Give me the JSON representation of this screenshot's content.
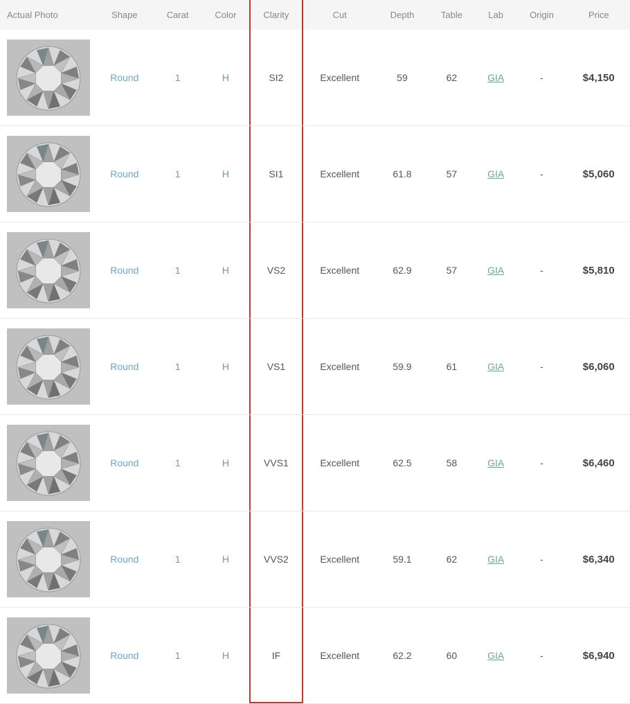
{
  "columns": {
    "actual_photo": "Actual Photo",
    "shape": "Shape",
    "carat": "Carat",
    "color": "Color",
    "clarity": "Clarity",
    "cut": "Cut",
    "depth": "Depth",
    "table": "Table",
    "lab": "Lab",
    "origin": "Origin",
    "price": "Price"
  },
  "rows": [
    {
      "shape": "Round",
      "carat": "1",
      "color": "H",
      "clarity": "SI2",
      "cut": "Excellent",
      "depth": "59",
      "table": "62",
      "lab": "GIA",
      "origin": "-",
      "price": "$4,150"
    },
    {
      "shape": "Round",
      "carat": "1",
      "color": "H",
      "clarity": "SI1",
      "cut": "Excellent",
      "depth": "61.8",
      "table": "57",
      "lab": "GIA",
      "origin": "-",
      "price": "$5,060"
    },
    {
      "shape": "Round",
      "carat": "1",
      "color": "H",
      "clarity": "VS2",
      "cut": "Excellent",
      "depth": "62.9",
      "table": "57",
      "lab": "GIA",
      "origin": "-",
      "price": "$5,810"
    },
    {
      "shape": "Round",
      "carat": "1",
      "color": "H",
      "clarity": "VS1",
      "cut": "Excellent",
      "depth": "59.9",
      "table": "61",
      "lab": "GIA",
      "origin": "-",
      "price": "$6,060"
    },
    {
      "shape": "Round",
      "carat": "1",
      "color": "H",
      "clarity": "VVS1",
      "cut": "Excellent",
      "depth": "62.5",
      "table": "58",
      "lab": "GIA",
      "origin": "-",
      "price": "$6,460"
    },
    {
      "shape": "Round",
      "carat": "1",
      "color": "H",
      "clarity": "VVS2",
      "cut": "Excellent",
      "depth": "59.1",
      "table": "62",
      "lab": "GIA",
      "origin": "-",
      "price": "$6,340"
    },
    {
      "shape": "Round",
      "carat": "1",
      "color": "H",
      "clarity": "IF",
      "cut": "Excellent",
      "depth": "62.2",
      "table": "60",
      "lab": "GIA",
      "origin": "-",
      "price": "$6,940"
    }
  ]
}
